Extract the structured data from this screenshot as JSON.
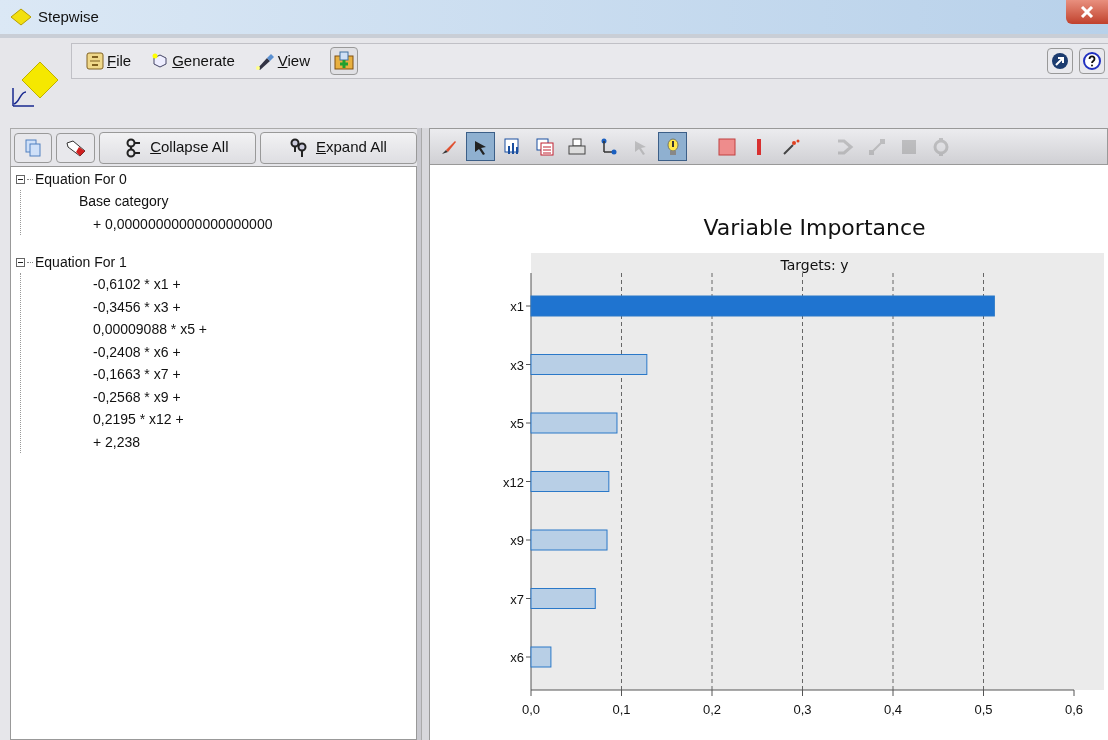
{
  "window": {
    "title": "Stepwise"
  },
  "menu": [
    {
      "label": "File",
      "kind": "file"
    },
    {
      "label": "Generate",
      "kind": "generate"
    },
    {
      "label": "View",
      "kind": "view"
    }
  ],
  "tree_toolbar": [
    {
      "label": "Collapse All",
      "kind": "collapse"
    },
    {
      "label": "Expand All",
      "kind": "expand"
    }
  ],
  "tree": [
    {
      "label": "Equation For 0",
      "expanded": true,
      "children": [
        {
          "label": "Base category"
        },
        {
          "label": "+ 0,00000000000000000000"
        }
      ]
    },
    {
      "label": "Equation For 1",
      "expanded": true,
      "children": [
        {
          "label": "-0,6102 * x1 +"
        },
        {
          "label": "-0,3456 * x3 +"
        },
        {
          "label": "0,00009088 * x5 +"
        },
        {
          "label": "-0,2408 * x6 +"
        },
        {
          "label": "-0,1663 * x7 +"
        },
        {
          "label": "-0,2568 * x9 +"
        },
        {
          "label": "0,2195 * x12 +"
        },
        {
          "label": "+ 2,238"
        }
      ]
    }
  ],
  "chart_toolbar": [
    {
      "kind": "brush",
      "selected": false,
      "disabled": false
    },
    {
      "kind": "pointer",
      "selected": true,
      "disabled": false
    },
    {
      "kind": "bars",
      "selected": false,
      "disabled": false
    },
    {
      "kind": "table",
      "selected": false,
      "disabled": false
    },
    {
      "kind": "print",
      "selected": false,
      "disabled": false
    },
    {
      "kind": "axis",
      "selected": false,
      "disabled": false
    },
    {
      "kind": "pointer",
      "selected": false,
      "disabled": true
    },
    {
      "kind": "bulb",
      "selected": true,
      "disabled": false
    },
    {
      "kind": "square",
      "selected": false,
      "disabled": false
    },
    {
      "kind": "line",
      "selected": false,
      "disabled": false
    },
    {
      "kind": "wand",
      "selected": false,
      "disabled": false
    },
    {
      "kind": "nodes",
      "selected": false,
      "disabled": true
    },
    {
      "kind": "link",
      "selected": false,
      "disabled": true
    },
    {
      "kind": "grid",
      "selected": false,
      "disabled": true
    },
    {
      "kind": "ring",
      "selected": false,
      "disabled": true
    }
  ],
  "chart": {
    "chart_data": {
      "type": "bar",
      "title": "Variable Importance",
      "xlabel": "Targets: y",
      "orientation": "horizontal",
      "categories": [
        "x1",
        "x3",
        "x5",
        "x12",
        "x9",
        "x7",
        "x6"
      ],
      "grid": true,
      "series": [
        {
          "color": "#1f74d0",
          "values": [
            0.512,
            null,
            null,
            null,
            null,
            null,
            null
          ]
        },
        {
          "color": "#b8cfe6",
          "values": [
            null,
            0.128,
            0.095,
            0.086,
            0.084,
            0.071,
            0.022
          ]
        }
      ],
      "xlim": [
        0,
        0.6
      ],
      "xticks": [
        {
          "value": 0,
          "label": "0,0"
        },
        {
          "value": 0.1,
          "label": "0,1"
        },
        {
          "value": 0.2,
          "label": "0,2"
        },
        {
          "value": 0.3,
          "label": "0,3"
        },
        {
          "value": 0.4,
          "label": "0,4"
        },
        {
          "value": 0.5,
          "label": "0,5"
        },
        {
          "value": 0.6,
          "label": "0,6"
        }
      ]
    }
  }
}
